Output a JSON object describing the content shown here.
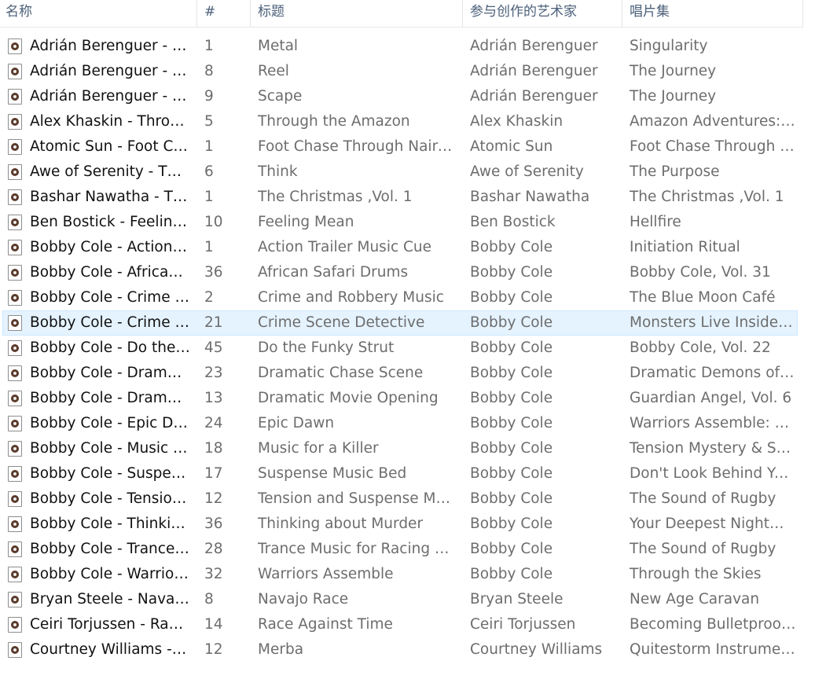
{
  "columns": {
    "name": "名称",
    "number": "#",
    "title": "标题",
    "artist": "参与创作的艺术家",
    "album": "唱片集"
  },
  "file_icon": "music-file-icon",
  "selected_row": 11,
  "colors": {
    "selection_bg": "#e5f3ff",
    "selection_border": "#cce8ff",
    "header_text": "#4c607a"
  },
  "rows": [
    {
      "name": "Adrián Berenguer - M...",
      "num": "1",
      "title": "Metal",
      "artist": "Adrián Berenguer",
      "album": "Singularity"
    },
    {
      "name": "Adrián Berenguer - R...",
      "num": "8",
      "title": "Reel",
      "artist": "Adrián Berenguer",
      "album": "The Journey"
    },
    {
      "name": "Adrián Berenguer - Sc...",
      "num": "9",
      "title": "Scape",
      "artist": "Adrián Berenguer",
      "album": "The Journey"
    },
    {
      "name": "Alex Khaskin - Throug...",
      "num": "5",
      "title": "Through the Amazon",
      "artist": "Alex Khaskin",
      "album": "Amazon Adventures: S..."
    },
    {
      "name": "Atomic Sun - Foot Ch...",
      "num": "1",
      "title": "Foot Chase Through Nairobi",
      "artist": "Atomic Sun",
      "album": "Foot Chase Through N..."
    },
    {
      "name": "Awe of Serenity - Thin...",
      "num": "6",
      "title": "Think",
      "artist": "Awe of Serenity",
      "album": "The Purpose"
    },
    {
      "name": "Bashar Nawatha - The...",
      "num": "1",
      "title": "The Christmas ,Vol. 1",
      "artist": "Bashar Nawatha",
      "album": "The Christmas ,Vol. 1"
    },
    {
      "name": "Ben Bostick - Feeling ...",
      "num": "10",
      "title": "Feeling Mean",
      "artist": "Ben Bostick",
      "album": "Hellfire"
    },
    {
      "name": "Bobby Cole - Action T...",
      "num": "1",
      "title": "Action Trailer Music Cue",
      "artist": "Bobby Cole",
      "album": "Initiation Ritual"
    },
    {
      "name": "Bobby Cole - African ...",
      "num": "36",
      "title": "African Safari Drums",
      "artist": "Bobby Cole",
      "album": "Bobby Cole, Vol. 31"
    },
    {
      "name": "Bobby Cole - Crime a...",
      "num": "2",
      "title": "Crime and Robbery Music",
      "artist": "Bobby Cole",
      "album": "The Blue Moon Café"
    },
    {
      "name": "Bobby Cole - Crime S...",
      "num": "21",
      "title": "Crime Scene Detective",
      "artist": "Bobby Cole",
      "album": "Monsters Live Inside Us"
    },
    {
      "name": "Bobby Cole - Do the ...",
      "num": "45",
      "title": "Do the Funky Strut",
      "artist": "Bobby Cole",
      "album": "Bobby Cole, Vol. 22"
    },
    {
      "name": "Bobby Cole - Dramati...",
      "num": "23",
      "title": "Dramatic Chase Scene",
      "artist": "Bobby Cole",
      "album": "Dramatic Demons of ..."
    },
    {
      "name": "Bobby Cole - Dramati...",
      "num": "13",
      "title": "Dramatic Movie Opening",
      "artist": "Bobby Cole",
      "album": "Guardian Angel, Vol. 6"
    },
    {
      "name": "Bobby Cole - Epic Da...",
      "num": "24",
      "title": "Epic Dawn",
      "artist": "Bobby Cole",
      "album": "Warriors Assemble: Epi..."
    },
    {
      "name": "Bobby Cole - Music f...",
      "num": "18",
      "title": "Music for a Killer",
      "artist": "Bobby Cole",
      "album": "Tension Mystery & Sus..."
    },
    {
      "name": "Bobby Cole - Suspens...",
      "num": "17",
      "title": "Suspense Music Bed",
      "artist": "Bobby Cole",
      "album": "Don't Look Behind You..."
    },
    {
      "name": "Bobby Cole - Tension ...",
      "num": "12",
      "title": "Tension and Suspense Musi...",
      "artist": "Bobby Cole",
      "album": "The Sound of Rugby"
    },
    {
      "name": "Bobby Cole - Thinkin...",
      "num": "36",
      "title": "Thinking about Murder",
      "artist": "Bobby Cole",
      "album": "Your Deepest Nightm..."
    },
    {
      "name": "Bobby Cole - Trance ...",
      "num": "28",
      "title": "Trance Music for Racing Ga...",
      "artist": "Bobby Cole",
      "album": "The Sound of Rugby"
    },
    {
      "name": "Bobby Cole - Warrior...",
      "num": "32",
      "title": "Warriors Assemble",
      "artist": "Bobby Cole",
      "album": "Through the Skies"
    },
    {
      "name": "Bryan Steele - Navajo ...",
      "num": "8",
      "title": "Navajo Race",
      "artist": "Bryan Steele",
      "album": "New Age Caravan"
    },
    {
      "name": "Ceiri Torjussen - Race ...",
      "num": "14",
      "title": "Race Against Time",
      "artist": "Ceiri Torjussen",
      "album": "Becoming Bulletproof ..."
    },
    {
      "name": "Courtney Williams - ...",
      "num": "12",
      "title": "Merba",
      "artist": "Courtney Williams",
      "album": "Quitestorm Instrument..."
    }
  ]
}
